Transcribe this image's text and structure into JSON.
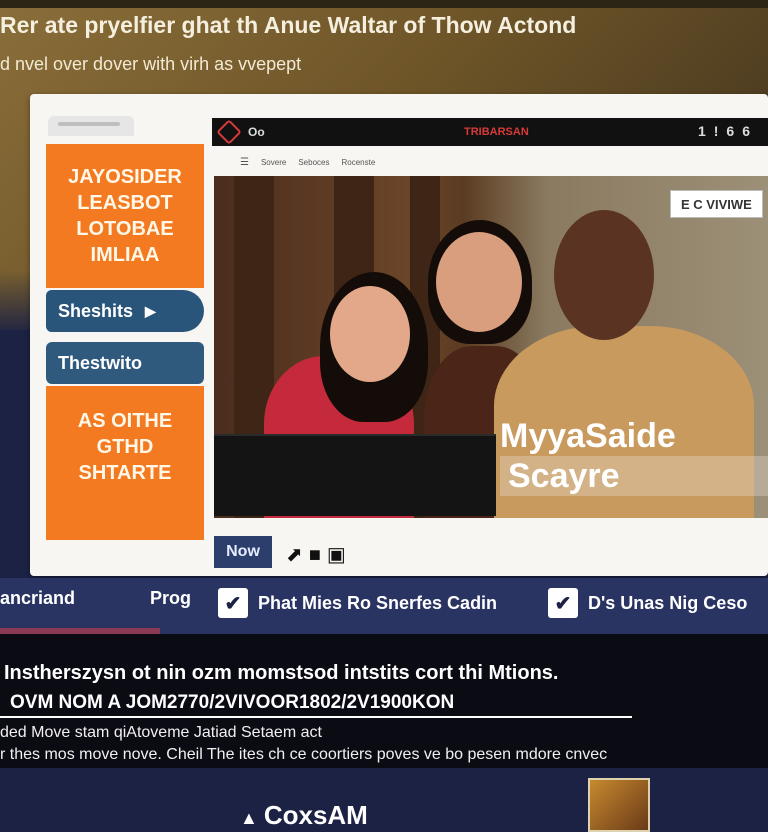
{
  "header": {
    "headline": "Rer ate pryelfier ghat th Anue Waltar of Thow Actond",
    "subline": "d nvel over dover with virh as vvepept"
  },
  "sidebar": {
    "promo_top": [
      "JAYOSIDER",
      "LEASBOT",
      "LOTOBAE",
      "IMLIAA"
    ],
    "button_share": "Sheshits",
    "button_second": "Thestwito",
    "promo_bottom": [
      "AS OITHE",
      "GTHD",
      "SHTARTE"
    ]
  },
  "app_bar": {
    "left_text": "Oo",
    "brand": "TRIBARSAN",
    "icons": [
      "1",
      "!",
      "6",
      "6"
    ]
  },
  "sub_nav": {
    "items": [
      "Sovere",
      "Seboces",
      "Rocenste"
    ]
  },
  "video": {
    "player_title": "CoxsAM",
    "overlay_line1": "MyyaSaide",
    "overlay_line2": "Scayre",
    "corner_badge": "E C VIVIWE",
    "now_button": "Now"
  },
  "check_bar": {
    "label_left": "ancriand",
    "label_prog": "Prog",
    "item1": "Phat Mies Ro Snerfes Cadin",
    "item2": "D's Unas Nig Ceso"
  },
  "bottom": {
    "line1": "Instherszysn ot nin ozm momstsod intstits cort thi Mtions.",
    "line2": "OVM NOM A JOM2770/2VIVOOR1802/2V1900KON",
    "line3": "ded Move stam qiAtoveme Jatiad Setaem act",
    "line4": "r thes mos move nove. Cheil The ites ch ce coortiers poves ve bo pesen mdore cnvec"
  }
}
